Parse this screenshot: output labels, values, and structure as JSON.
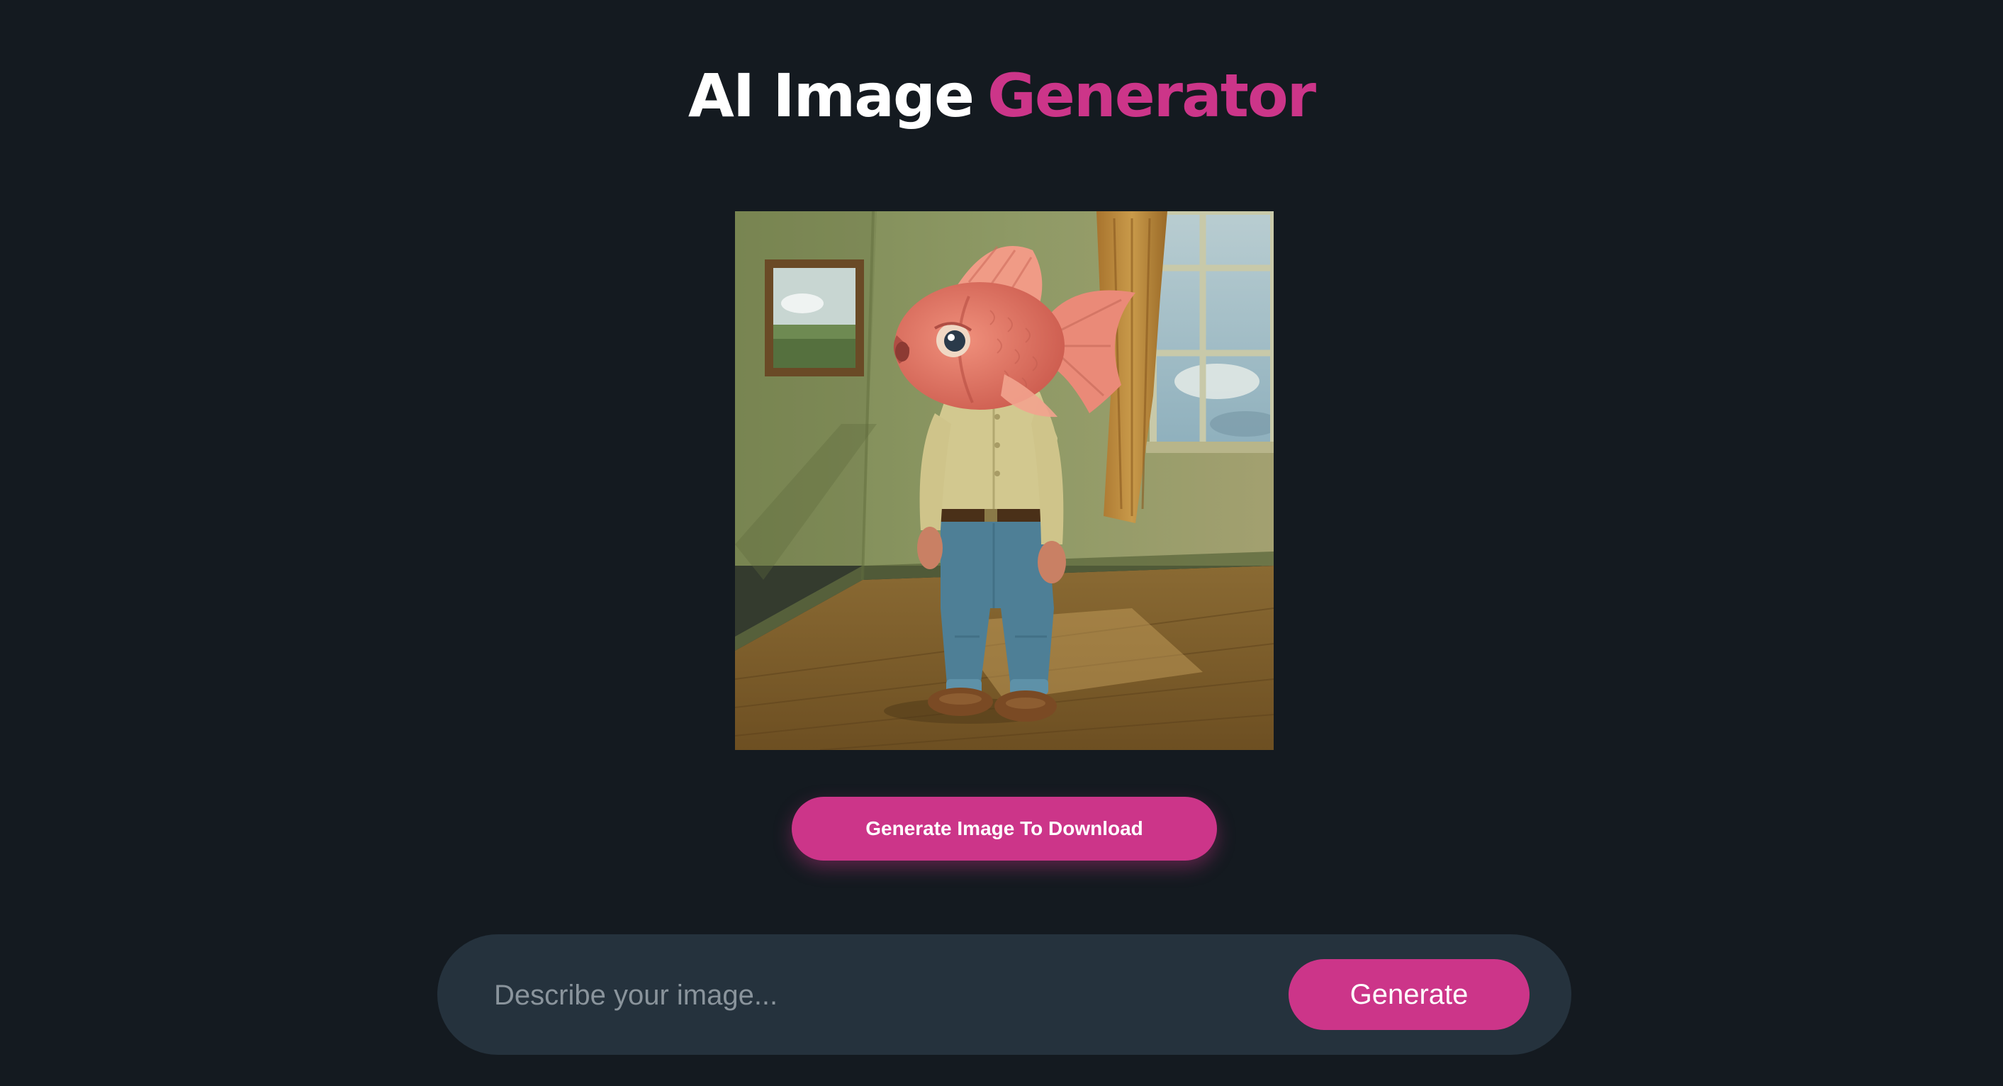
{
  "header": {
    "title_main": "AI Image",
    "title_accent": "Generator"
  },
  "preview": {
    "icon": "generated-image-preview"
  },
  "actions": {
    "download_label": "Generate Image To Download"
  },
  "prompt": {
    "placeholder": "Describe your image...",
    "value": "",
    "generate_label": "Generate"
  },
  "colors": {
    "background": "#141a20",
    "accent": "#cc3589",
    "prompt_bar": "#25323d",
    "title_text": "#ffffff",
    "placeholder_text": "#8a949c"
  }
}
